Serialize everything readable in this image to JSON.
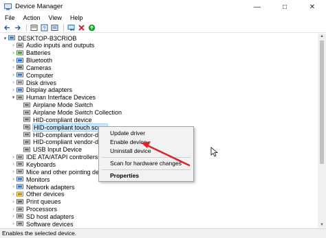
{
  "window": {
    "title": "Device Manager",
    "controls": [
      "—",
      "□",
      "✕"
    ]
  },
  "menu": [
    "File",
    "Action",
    "View",
    "Help"
  ],
  "toolbar": [
    "back-icon",
    "forward-icon",
    "properties-icon",
    "help-icon",
    "scan-icon",
    "monitor-icon",
    "uninstall-icon",
    "enable-icon"
  ],
  "tree": [
    {
      "label": "DESKTOP-B3CRIOB",
      "level": 0,
      "arrow": "▾",
      "icon": "computer"
    },
    {
      "label": "Audio inputs and outputs",
      "level": 1,
      "arrow": "›",
      "icon": "audio"
    },
    {
      "label": "Batteries",
      "level": 1,
      "arrow": "›",
      "icon": "battery"
    },
    {
      "label": "Bluetooth",
      "level": 1,
      "arrow": "›",
      "icon": "bluetooth"
    },
    {
      "label": "Cameras",
      "level": 1,
      "arrow": "›",
      "icon": "camera"
    },
    {
      "label": "Computer",
      "level": 1,
      "arrow": "›",
      "icon": "monitor"
    },
    {
      "label": "Disk drives",
      "level": 1,
      "arrow": "›",
      "icon": "disk"
    },
    {
      "label": "Display adapters",
      "level": 1,
      "arrow": "›",
      "icon": "display"
    },
    {
      "label": "Human Interface Devices",
      "level": 1,
      "arrow": "▾",
      "icon": "hid"
    },
    {
      "label": "Airplane Mode Switch",
      "level": 2,
      "arrow": "",
      "icon": "hid"
    },
    {
      "label": "Airplane Mode Switch Collection",
      "level": 2,
      "arrow": "",
      "icon": "hid"
    },
    {
      "label": "HID-compliant device",
      "level": 2,
      "arrow": "",
      "icon": "hid"
    },
    {
      "label": "HID-compliant touch scree",
      "level": 2,
      "arrow": "",
      "icon": "hid-disabled",
      "selected": true
    },
    {
      "label": "HID-compliant vendor-defi",
      "level": 2,
      "arrow": "",
      "icon": "hid"
    },
    {
      "label": "HID-compliant vendor-defi",
      "level": 2,
      "arrow": "",
      "icon": "hid"
    },
    {
      "label": "USB Input Device",
      "level": 2,
      "arrow": "",
      "icon": "hid"
    },
    {
      "label": "IDE ATA/ATAPI controllers",
      "level": 1,
      "arrow": "›",
      "icon": "ide"
    },
    {
      "label": "Keyboards",
      "level": 1,
      "arrow": "›",
      "icon": "keyboard"
    },
    {
      "label": "Mice and other pointing device",
      "level": 1,
      "arrow": "›",
      "icon": "mouse"
    },
    {
      "label": "Monitors",
      "level": 1,
      "arrow": "›",
      "icon": "monitor"
    },
    {
      "label": "Network adapters",
      "level": 1,
      "arrow": "›",
      "icon": "network"
    },
    {
      "label": "Other devices",
      "level": 1,
      "arrow": "›",
      "icon": "other"
    },
    {
      "label": "Print queues",
      "level": 1,
      "arrow": "›",
      "icon": "printer"
    },
    {
      "label": "Processors",
      "level": 1,
      "arrow": "›",
      "icon": "cpu"
    },
    {
      "label": "SD host adapters",
      "level": 1,
      "arrow": "›",
      "icon": "sd"
    },
    {
      "label": "Software devices",
      "level": 1,
      "arrow": "›",
      "icon": "software"
    }
  ],
  "context_menu": {
    "items": [
      "Update driver",
      "Enable device",
      "Uninstall device",
      "Scan for hardware changes",
      "Properties"
    ]
  },
  "status": "Enables the selected device.",
  "colors": {
    "selection": "#cce8ff",
    "arrow": "#d9262a",
    "enable": "#1a9a2c",
    "uninstall": "#d51e1e"
  }
}
